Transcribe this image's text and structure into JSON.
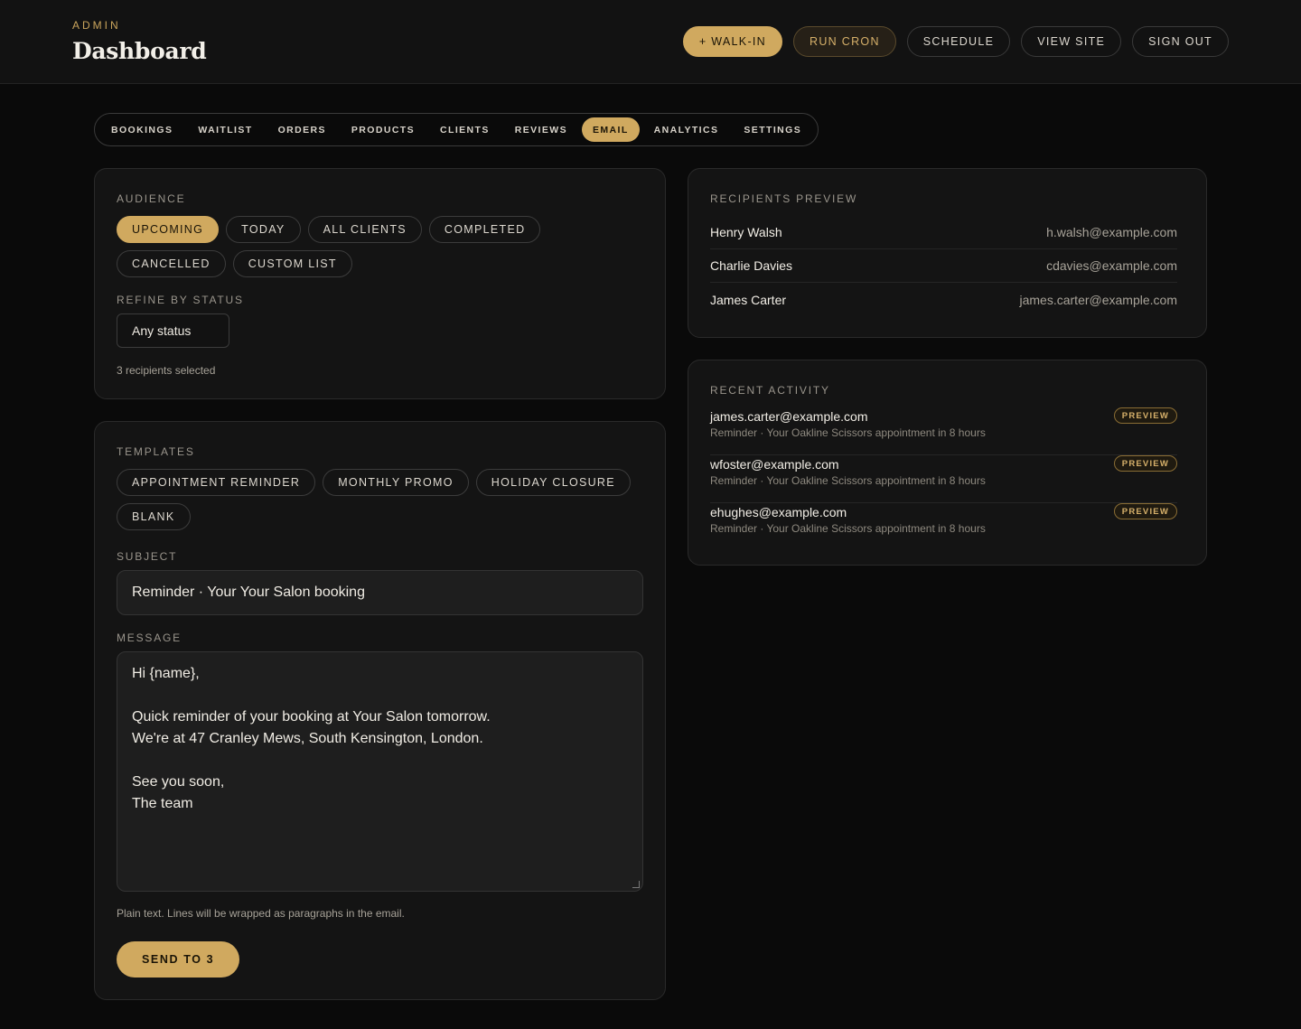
{
  "header": {
    "eyebrow": "ADMIN",
    "title": "Dashboard",
    "actions": [
      "+ WALK-IN",
      "RUN CRON",
      "SCHEDULE",
      "VIEW SITE",
      "SIGN OUT"
    ]
  },
  "tabs": [
    {
      "label": "BOOKINGS"
    },
    {
      "label": "WAITLIST"
    },
    {
      "label": "ORDERS"
    },
    {
      "label": "PRODUCTS"
    },
    {
      "label": "CLIENTS"
    },
    {
      "label": "REVIEWS"
    },
    {
      "label": "EMAIL",
      "active": true
    },
    {
      "label": "ANALYTICS"
    },
    {
      "label": "SETTINGS"
    }
  ],
  "audience": {
    "label": "AUDIENCE",
    "options": [
      "UPCOMING",
      "TODAY",
      "ALL CLIENTS",
      "COMPLETED",
      "CANCELLED",
      "CUSTOM LIST"
    ],
    "selected": "UPCOMING",
    "refine_label": "REFINE BY STATUS",
    "status_value": "Any status",
    "recipients_note": "3 recipients selected"
  },
  "compose": {
    "templates_label": "TEMPLATES",
    "templates": [
      "APPOINTMENT REMINDER",
      "MONTHLY PROMO",
      "HOLIDAY CLOSURE",
      "BLANK"
    ],
    "subject_label": "SUBJECT",
    "subject_value": "Reminder · Your Your Salon booking",
    "message_label": "MESSAGE",
    "message_lines": [
      "Hi {name},",
      "",
      "Quick reminder of your booking at Your Salon tomorrow.",
      "We're at 47 Cranley Mews, South Kensington, London.",
      "",
      "See you soon,",
      "The team"
    ],
    "hint": "Plain text. Lines will be wrapped as paragraphs in the email.",
    "send_label": "SEND TO 3"
  },
  "recipients": {
    "label": "RECIPIENTS PREVIEW",
    "items": [
      {
        "name": "Henry Walsh",
        "email": "h.walsh@example.com"
      },
      {
        "name": "Charlie Davies",
        "email": "cdavies@example.com"
      },
      {
        "name": "James Carter",
        "email": "james.carter@example.com"
      }
    ]
  },
  "activity": {
    "label": "RECENT ACTIVITY",
    "items": [
      {
        "email": "james.carter@example.com",
        "desc": "Reminder · Your Oakline Scissors appointment in 8 hours",
        "badge": "PREVIEW"
      },
      {
        "email": "wfoster@example.com",
        "desc": "Reminder · Your Oakline Scissors appointment in 8 hours",
        "badge": "PREVIEW"
      },
      {
        "email": "ehughes@example.com",
        "desc": "Reminder · Your Oakline Scissors appointment in 8 hours",
        "badge": "PREVIEW"
      }
    ]
  },
  "colors": {
    "background": "#0a0a0a",
    "card": "#141414",
    "accent": "#d0a95f"
  }
}
